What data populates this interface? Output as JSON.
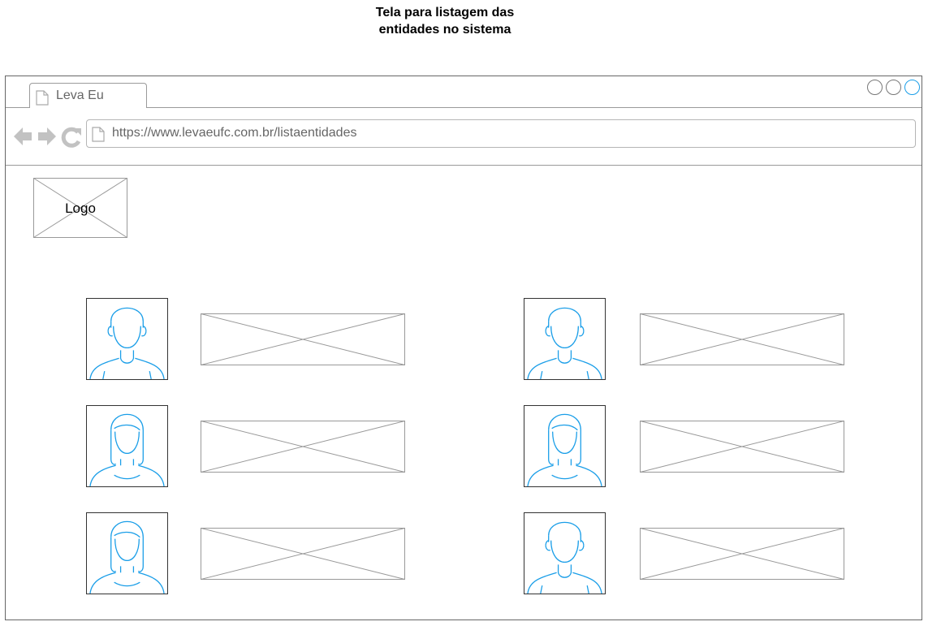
{
  "page": {
    "title_line1": "Tela para listagem das",
    "title_line2": "entidades no sistema"
  },
  "browser": {
    "tab_label": "Leva Eu",
    "url": "https://www.levaeufc.com.br/listaentidades"
  },
  "logo": {
    "label": "Logo"
  },
  "entities": [
    {
      "avatar": "male-avatar-icon"
    },
    {
      "avatar": "male-avatar-icon"
    },
    {
      "avatar": "female-avatar-icon"
    },
    {
      "avatar": "female-avatar-icon"
    },
    {
      "avatar": "female-avatar-icon"
    },
    {
      "avatar": "male-avatar-icon"
    }
  ],
  "colors": {
    "accent": "#1a9ee8",
    "wireframe": "#999999",
    "border": "#666666"
  }
}
